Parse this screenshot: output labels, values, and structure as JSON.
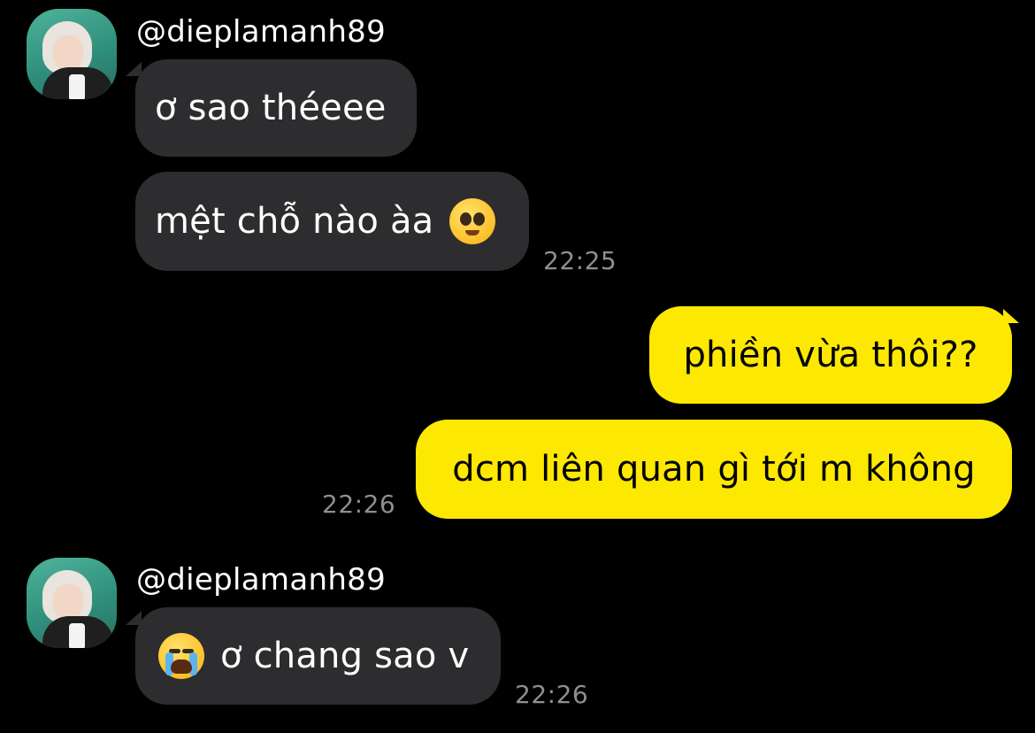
{
  "colors": {
    "background": "#000000",
    "incoming_bubble": "#2d2d2f",
    "outgoing_bubble": "#fde802",
    "timestamp": "#8e8e93"
  },
  "messages": [
    {
      "sender": "@dieplamanh89",
      "direction": "incoming",
      "bubbles": [
        {
          "text": "ơ sao théeee"
        },
        {
          "text": "mệt chỗ nào àa",
          "emoji": "pleading-face-icon"
        }
      ],
      "time": "22:25"
    },
    {
      "direction": "outgoing",
      "bubbles": [
        {
          "text": "phiền vừa thôi??"
        },
        {
          "text": "dcm liên quan gì tới m không"
        }
      ],
      "time": "22:26"
    },
    {
      "sender": "@dieplamanh89",
      "direction": "incoming",
      "bubbles": [
        {
          "text": "ơ chang sao v",
          "emoji": "loudly-crying-face-icon"
        }
      ],
      "time": "22:26"
    }
  ]
}
